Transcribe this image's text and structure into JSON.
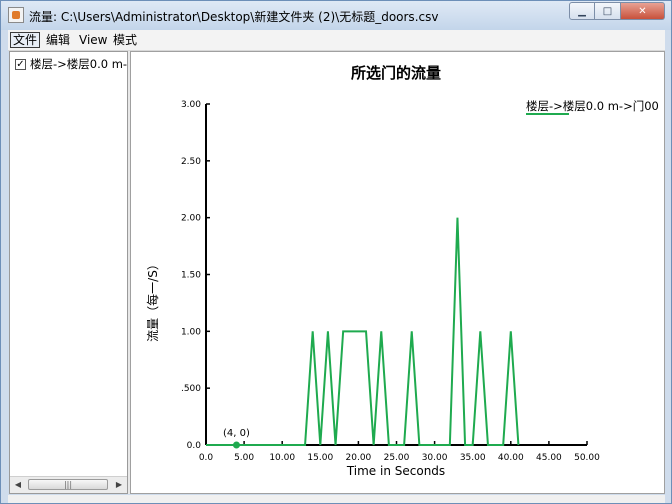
{
  "window": {
    "title": "流量: C:\\Users\\Administrator\\Desktop\\新建文件夹 (2)\\无标题_doors.csv"
  },
  "menu": [
    "文件",
    "编辑",
    "View",
    "模式"
  ],
  "tree": {
    "items": [
      {
        "label": "楼层->楼层0.0 m->门00",
        "checked": true
      }
    ]
  },
  "chart_data": {
    "type": "line",
    "title": "所选门的流量",
    "xlabel": "Time in Seconds",
    "ylabel": "流量（每一/S）",
    "xlim": [
      0,
      50
    ],
    "ylim": [
      0,
      3
    ],
    "x_ticks": [
      "0.0",
      "5.00",
      "10.00",
      "15.00",
      "20.00",
      "25.00",
      "30.00",
      "35.00",
      "40.00",
      "45.00",
      "50.00"
    ],
    "y_ticks": [
      "0.0",
      ".500",
      "1.00",
      "1.50",
      "2.00",
      "2.50",
      "3.00"
    ],
    "x_tick_values": [
      0,
      5,
      10,
      15,
      20,
      25,
      30,
      35,
      40,
      45,
      50
    ],
    "y_tick_values": [
      0,
      0.5,
      1,
      1.5,
      2,
      2.5,
      3
    ],
    "grid": false,
    "legend_position": "top-right",
    "series": [
      {
        "name": "楼层->楼层0.0 m->门00",
        "color": "#1faa4f",
        "x": [
          0,
          13,
          14,
          15,
          16,
          17,
          18,
          19,
          20,
          21,
          22,
          23,
          24,
          26,
          27,
          28,
          32,
          33,
          34,
          35,
          36,
          37,
          39,
          40,
          41
        ],
        "y": [
          0,
          0,
          1,
          0,
          1,
          0,
          1,
          1,
          1,
          1,
          0,
          1,
          0,
          0,
          1,
          0,
          0,
          2,
          0,
          0,
          1,
          0,
          0,
          1,
          0
        ]
      }
    ],
    "annotation": {
      "text": "(4, 0)",
      "x": 4,
      "y": 0
    }
  }
}
